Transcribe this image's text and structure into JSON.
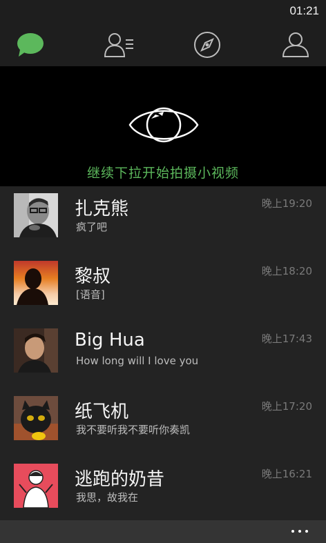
{
  "status_bar": {
    "time": "01:21"
  },
  "tabs": [
    {
      "name": "chats",
      "icon": "chat-bubble-icon",
      "active": true
    },
    {
      "name": "contacts",
      "icon": "contacts-icon",
      "active": false
    },
    {
      "name": "discover",
      "icon": "compass-icon",
      "active": false
    },
    {
      "name": "me",
      "icon": "person-icon",
      "active": false
    }
  ],
  "pull_panel": {
    "icon": "eye-icon",
    "hint": "继续下拉开始拍摄小视频"
  },
  "chats": [
    {
      "name": "扎克熊",
      "preview": "疯了吧",
      "time": "晚上19:20"
    },
    {
      "name": "黎叔",
      "preview": "[语音]",
      "time": "晚上18:20"
    },
    {
      "name": "Big Hua",
      "preview": "How long will I love you",
      "time": "晚上17:43"
    },
    {
      "name": "纸飞机",
      "preview": "我不要听我不要听你奏凯",
      "time": "晚上17:20"
    },
    {
      "name": "逃跑的奶昔",
      "preview": "我思，故我在",
      "time": "晚上16:21"
    }
  ],
  "bottom_bar": {
    "more_icon": "more-dots-icon"
  },
  "colors": {
    "accent": "#5cb85c",
    "background": "#232323",
    "header": "#1e1e1e",
    "bottom_bar": "#343434"
  }
}
